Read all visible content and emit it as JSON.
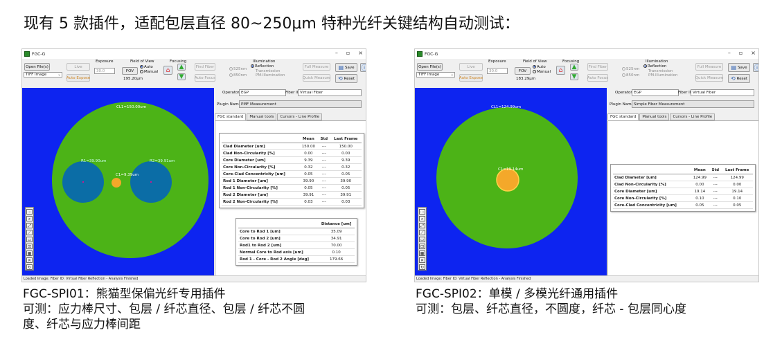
{
  "heading": "现有 5 款插件，适配包层直径 80~250μm 特种光纤关键结构自动测试：",
  "common": {
    "app_title": "FGC-G",
    "win_min": "–",
    "win_max": "▫",
    "win_close": "×",
    "open_files": "Open File(s)",
    "file_type": "TIFF Image",
    "exposure_title": "Exposure",
    "live": "Live",
    "exposure_value": "30.0",
    "auto_expose": "Auto Expose",
    "fov_title": "Field of View",
    "fov_button": "FOV",
    "fov_auto": "Auto",
    "fov_manual": "Manual",
    "focusing_title": "Focusing",
    "find_fiber": "Find Fiber",
    "auto_focus": "Auto Focus",
    "illum_title": "Illumination",
    "nm525": "525nm",
    "nm850": "850nm",
    "reflection": "Reflection",
    "transmission": "Transmission",
    "pm_illum": "PM-Illumination",
    "full_measure": "Full Measure",
    "quick_measure": "Quick Measure",
    "save": "Save",
    "reset": "Reset",
    "operator_label": "Operator",
    "operator_value": "EGP",
    "fiberid_label": "Fiber ID",
    "fiberid_value": "Virtual Fiber",
    "plugin_label": "Plugin Name",
    "tab_standard": "FGC standard",
    "tab_manual": "Manual tools",
    "tab_cursors": "Cursors - Line Profile",
    "col_mean": "Mean",
    "col_std": "Std",
    "col_last": "Last Frame",
    "status": "Loaded Image: Fiber ID: Virtual Fiber Reflection - Analysis Finished"
  },
  "panel1": {
    "fov_value": "195.20μm",
    "plugin_value": "PMF Measurement",
    "clad_label": "CL1=150.00um",
    "rod1_label": "R1=39.90um",
    "rod2_label": "R2=39.91um",
    "core_label": "C1=9.39um",
    "rows": [
      {
        "name": "Clad Diameter [um]",
        "mean": "150.00",
        "std": "---",
        "last": "150.00"
      },
      {
        "name": "Clad Non-Circularity [%]",
        "mean": "0.00",
        "std": "---",
        "last": "0.00"
      },
      {
        "name": "Core Diameter [um]",
        "mean": "9.39",
        "std": "---",
        "last": "9.39"
      },
      {
        "name": "Core Non-Circularity [%]",
        "mean": "0.32",
        "std": "---",
        "last": "0.32"
      },
      {
        "name": "Core-Clad Concentricity [um]",
        "mean": "0.05",
        "std": "---",
        "last": "0.05"
      },
      {
        "name": "Rod 1 Diameter [um]",
        "mean": "39.90",
        "std": "---",
        "last": "39.90"
      },
      {
        "name": "Rod 1 Non-Circularity [%]",
        "mean": "0.05",
        "std": "---",
        "last": "0.05"
      },
      {
        "name": "Rod 2 Diameter [um]",
        "mean": "39.91",
        "std": "---",
        "last": "39.91"
      },
      {
        "name": "Rod 2 Non-Circularity [%]",
        "mean": "0.03",
        "std": "---",
        "last": "0.03"
      }
    ],
    "dist_header": "Distance [um]",
    "dist_rows": [
      {
        "name": "Core to Rod 1 [um]",
        "value": "35.09"
      },
      {
        "name": "Core to Rod 2 [um]",
        "value": "34.91"
      },
      {
        "name": "Rod1 to Rod 2 [um]",
        "value": "70.00"
      },
      {
        "name": "Normal Core to Rod axis [um]",
        "value": "0.10"
      },
      {
        "name": "Rod 1 - Core - Rod 2 Angle [deg]",
        "value": "179.66"
      }
    ],
    "caption_1": "FGC-SPI01：熊猫型保偏光纤专用插件",
    "caption_2": "可测：应力棒尺寸、包层 / 纤芯直径、包层 / 纤芯不圆",
    "caption_3": "度、纤芯与应力棒间距"
  },
  "panel2": {
    "fov_value": "183.29μm",
    "plugin_value": "Simple Fiber Measurement",
    "clad_label": "CL1=124.99um",
    "core_label": "C1=19.14um",
    "rows": [
      {
        "name": "Clad Diameter [um]",
        "mean": "124.99",
        "std": "---",
        "last": "124.99"
      },
      {
        "name": "Clad Non-Circularity [%]",
        "mean": "0.00",
        "std": "---",
        "last": "0.00"
      },
      {
        "name": "Core Diameter [um]",
        "mean": "19.14",
        "std": "---",
        "last": "19.14"
      },
      {
        "name": "Core Non-Circularity [%]",
        "mean": "0.10",
        "std": "---",
        "last": "0.10"
      },
      {
        "name": "Core-Clad Concentricity [um]",
        "mean": "0.05",
        "std": "---",
        "last": "0.05"
      }
    ],
    "caption_1": "FGC-SPI02：单模 / 多模光纤通用插件",
    "caption_2": "可测：包层、纤芯直径，不圆度，纤芯 - 包层同心度"
  }
}
